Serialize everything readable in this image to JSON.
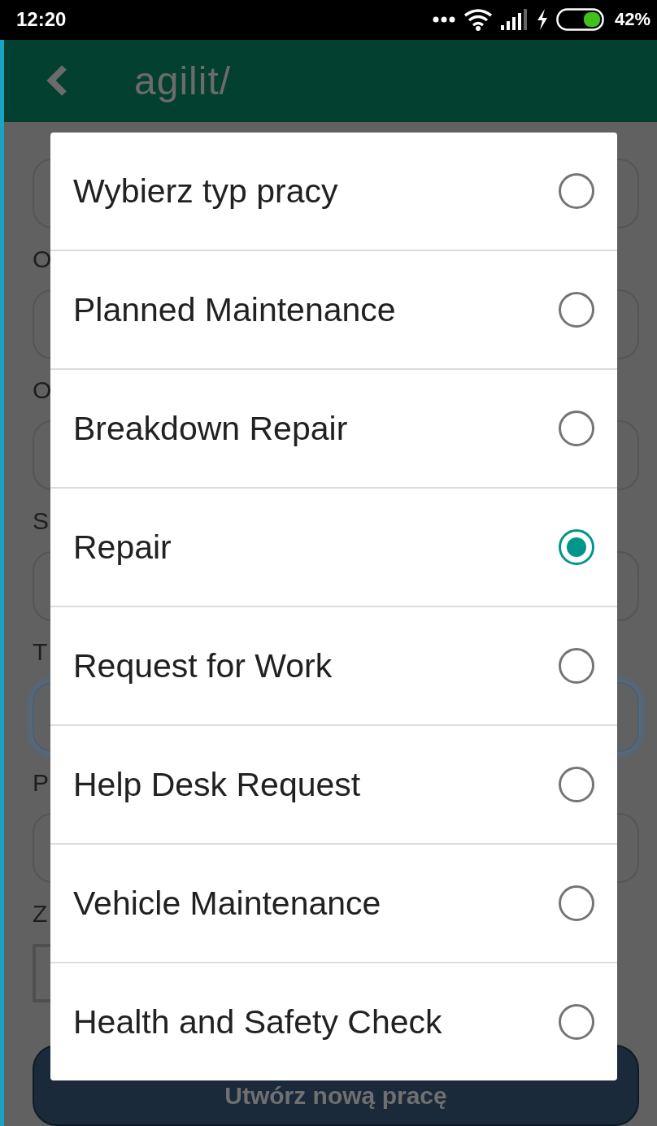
{
  "status_bar": {
    "time": "12:20",
    "battery": "42%"
  },
  "header": {
    "logo": "agilit/"
  },
  "form": {
    "items": [
      {
        "kind": "field",
        "focused": false
      },
      {
        "kind": "label",
        "text": "O"
      },
      {
        "kind": "field",
        "focused": false
      },
      {
        "kind": "label",
        "text": "O"
      },
      {
        "kind": "field",
        "focused": false
      },
      {
        "kind": "label",
        "text": "S"
      },
      {
        "kind": "field",
        "focused": false
      },
      {
        "kind": "label",
        "text": "T"
      },
      {
        "kind": "field",
        "focused": true
      },
      {
        "kind": "label",
        "text": "P"
      },
      {
        "kind": "field",
        "focused": false
      },
      {
        "kind": "label",
        "text": "Z"
      },
      {
        "kind": "checkbox",
        "checked": false
      },
      {
        "kind": "button",
        "text": "Utwórz nową pracę"
      }
    ]
  },
  "dialog": {
    "options": [
      {
        "label": "Wybierz typ pracy",
        "selected": false
      },
      {
        "label": "Planned Maintenance",
        "selected": false
      },
      {
        "label": "Breakdown Repair",
        "selected": false
      },
      {
        "label": "Repair",
        "selected": true
      },
      {
        "label": "Request for Work",
        "selected": false
      },
      {
        "label": "Help Desk Request",
        "selected": false
      },
      {
        "label": "Vehicle Maintenance",
        "selected": false
      },
      {
        "label": "Health and Safety Check",
        "selected": false
      }
    ]
  }
}
